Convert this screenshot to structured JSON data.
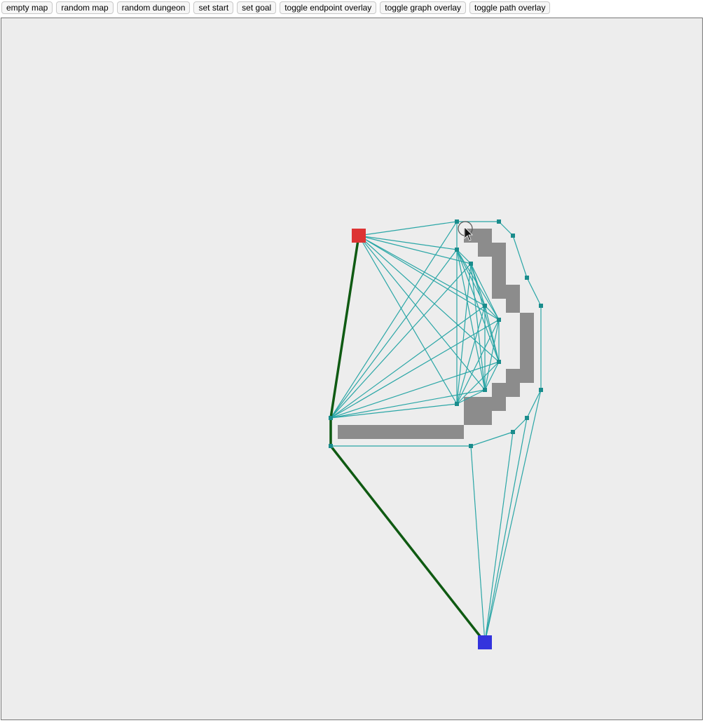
{
  "toolbar": {
    "buttons": [
      {
        "name": "empty-map-button",
        "label": "empty map"
      },
      {
        "name": "random-map-button",
        "label": "random map"
      },
      {
        "name": "random-dungeon-button",
        "label": "random dungeon"
      },
      {
        "name": "set-start-button",
        "label": "set start"
      },
      {
        "name": "set-goal-button",
        "label": "set goal"
      },
      {
        "name": "toggle-endpoint-overlay-button",
        "label": "toggle endpoint overlay"
      },
      {
        "name": "toggle-graph-overlay-button",
        "label": "toggle graph overlay"
      },
      {
        "name": "toggle-path-overlay-button",
        "label": "toggle path overlay"
      }
    ]
  },
  "map": {
    "grid_cols": 50,
    "grid_rows": 50,
    "colors": {
      "background": "#ededed",
      "wall": "#8c8c8c",
      "graph_edge": "#2aa6a6",
      "graph_node": "#1a8c8c",
      "path": "#0f5a12",
      "start": "#dd3333",
      "goal": "#3333dd"
    },
    "start": [
      25,
      15
    ],
    "goal": [
      34,
      44
    ],
    "walls": [
      [
        33,
        15
      ],
      [
        34,
        15
      ],
      [
        34,
        16
      ],
      [
        35,
        16
      ],
      [
        35,
        17
      ],
      [
        35,
        18
      ],
      [
        35,
        19
      ],
      [
        36,
        19
      ],
      [
        36,
        20
      ],
      [
        37,
        21
      ],
      [
        37,
        22
      ],
      [
        37,
        23
      ],
      [
        37,
        24
      ],
      [
        37,
        25
      ],
      [
        36,
        25
      ],
      [
        36,
        26
      ],
      [
        35,
        26
      ],
      [
        35,
        27
      ],
      [
        34,
        27
      ],
      [
        33,
        27
      ],
      [
        33,
        28
      ],
      [
        34,
        28
      ],
      [
        24,
        29
      ],
      [
        25,
        29
      ],
      [
        26,
        29
      ],
      [
        27,
        29
      ],
      [
        28,
        29
      ],
      [
        29,
        29
      ],
      [
        30,
        29
      ],
      [
        31,
        29
      ],
      [
        32,
        29
      ]
    ],
    "nodes": [
      [
        32,
        14
      ],
      [
        35,
        14
      ],
      [
        36,
        15
      ],
      [
        37,
        18
      ],
      [
        38,
        20
      ],
      [
        38,
        26
      ],
      [
        37,
        28
      ],
      [
        36,
        29
      ],
      [
        33,
        30
      ],
      [
        32,
        16
      ],
      [
        33,
        17
      ],
      [
        34,
        20
      ],
      [
        35,
        21
      ],
      [
        35,
        24
      ],
      [
        34,
        26
      ],
      [
        32,
        27
      ],
      [
        23,
        28
      ],
      [
        23,
        30
      ]
    ],
    "graph_edges": [
      [
        -1,
        0
      ],
      [
        -1,
        9
      ],
      [
        -1,
        10
      ],
      [
        -1,
        11
      ],
      [
        -1,
        12
      ],
      [
        -1,
        13
      ],
      [
        -1,
        14
      ],
      [
        -1,
        15
      ],
      [
        0,
        1
      ],
      [
        0,
        9
      ],
      [
        1,
        2
      ],
      [
        2,
        3
      ],
      [
        3,
        4
      ],
      [
        4,
        5
      ],
      [
        5,
        6
      ],
      [
        6,
        7
      ],
      [
        7,
        8
      ],
      [
        8,
        17
      ],
      [
        17,
        16
      ],
      [
        16,
        0
      ],
      [
        16,
        9
      ],
      [
        16,
        10
      ],
      [
        16,
        11
      ],
      [
        16,
        12
      ],
      [
        16,
        13
      ],
      [
        16,
        14
      ],
      [
        16,
        15
      ],
      [
        9,
        10
      ],
      [
        9,
        11
      ],
      [
        9,
        12
      ],
      [
        9,
        13
      ],
      [
        9,
        14
      ],
      [
        9,
        15
      ],
      [
        10,
        11
      ],
      [
        10,
        12
      ],
      [
        10,
        13
      ],
      [
        10,
        14
      ],
      [
        10,
        15
      ],
      [
        11,
        12
      ],
      [
        11,
        13
      ],
      [
        11,
        14
      ],
      [
        11,
        15
      ],
      [
        12,
        13
      ],
      [
        12,
        14
      ],
      [
        12,
        15
      ],
      [
        13,
        14
      ],
      [
        13,
        15
      ],
      [
        14,
        15
      ],
      [
        -2,
        8
      ],
      [
        -2,
        7
      ],
      [
        -2,
        6
      ],
      [
        -2,
        5
      ],
      [
        -2,
        17
      ]
    ],
    "path": [
      [
        25,
        15
      ],
      [
        23,
        28
      ],
      [
        23,
        30
      ],
      [
        34,
        44
      ]
    ]
  }
}
